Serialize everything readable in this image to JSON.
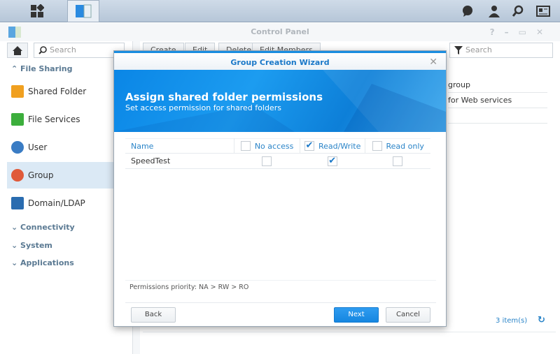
{
  "window": {
    "title": "Control Panel"
  },
  "sidebar": {
    "search_placeholder": "Search",
    "sections": {
      "file_sharing": "File Sharing",
      "connectivity": "Connectivity",
      "system": "System",
      "applications": "Applications"
    },
    "items": [
      {
        "label": "Shared Folder",
        "color": "#f0a020"
      },
      {
        "label": "File Services",
        "color": "#3cae3c"
      },
      {
        "label": "User",
        "color": "#3a7cc4"
      },
      {
        "label": "Group",
        "color": "#e05a3a"
      },
      {
        "label": "Domain/LDAP",
        "color": "#2a6cb0"
      }
    ],
    "selected": "Group"
  },
  "toolbar": {
    "create": "Create",
    "edit": "Edit",
    "delete": "Delete",
    "edit_members": "Edit Members",
    "search_placeholder": "Search"
  },
  "list": {
    "rows": [
      "group",
      "for Web services"
    ],
    "count": "3 item(s)"
  },
  "dialog": {
    "title": "Group Creation Wizard",
    "heading": "Assign shared folder permissions",
    "subheading": "Set access permission for shared folders",
    "columns": {
      "name": "Name",
      "no_access": "No access",
      "read_write": "Read/Write",
      "read_only": "Read only"
    },
    "header_checks": {
      "no_access": false,
      "read_write": true,
      "read_only": false
    },
    "rows": [
      {
        "name": "SpeedTest",
        "no_access": false,
        "read_write": true,
        "read_only": false
      }
    ],
    "priority": "Permissions priority: NA > RW > RO",
    "back": "Back",
    "next": "Next",
    "cancel": "Cancel"
  },
  "accent": "#1a8de0"
}
